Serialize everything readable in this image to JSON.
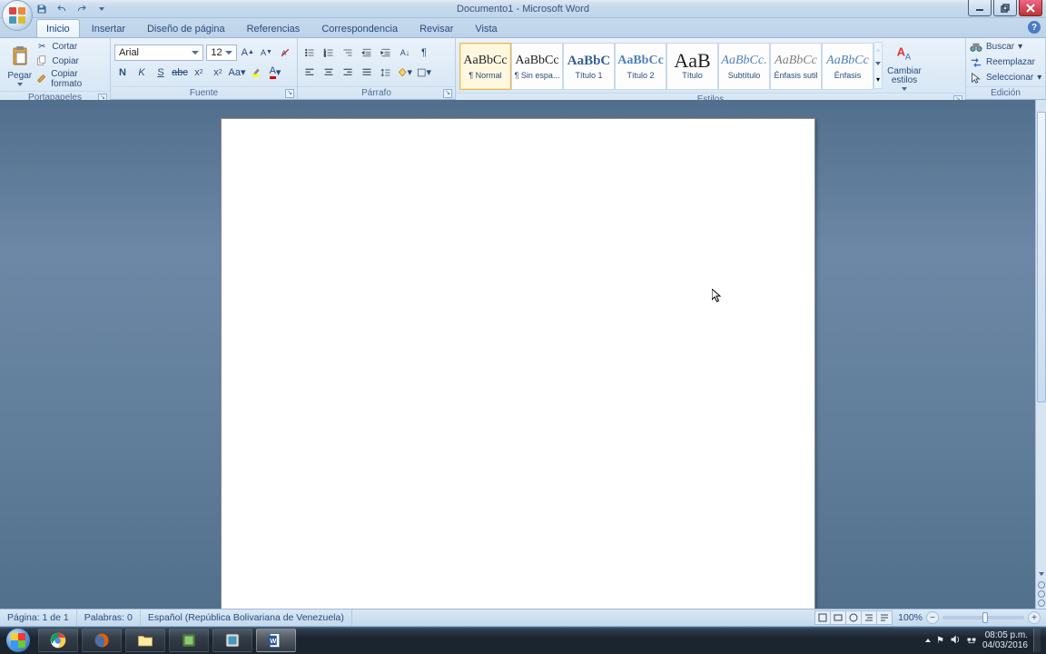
{
  "titlebar": {
    "doc_title": "Documento1 - Microsoft Word"
  },
  "tabs": {
    "inicio": "Inicio",
    "insertar": "Insertar",
    "diseno": "Diseño de página",
    "referencias": "Referencias",
    "correspondencia": "Correspondencia",
    "revisar": "Revisar",
    "vista": "Vista"
  },
  "ribbon": {
    "clipboard": {
      "paste": "Pegar",
      "cut": "Cortar",
      "copy": "Copiar",
      "format_painter": "Copiar formato",
      "label": "Portapapeles"
    },
    "font": {
      "name": "Arial",
      "size": "12",
      "label": "Fuente"
    },
    "paragraph": {
      "label": "Párrafo"
    },
    "styles": {
      "label": "Estilos",
      "change": "Cambiar estilos",
      "items": [
        {
          "preview": "AaBbCc",
          "name": "¶ Normal",
          "selected": true
        },
        {
          "preview": "AaBbCc",
          "name": "¶ Sin espa...",
          "selected": false
        },
        {
          "preview": "AaBbC",
          "name": "Título 1",
          "selected": false,
          "color": "#365f91",
          "size": "15px",
          "weight": "bold"
        },
        {
          "preview": "AaBbCc",
          "name": "Título 2",
          "selected": false,
          "color": "#4f81bd",
          "size": "14px",
          "weight": "bold"
        },
        {
          "preview": "AaB",
          "name": "Título",
          "selected": false,
          "size": "22px"
        },
        {
          "preview": "AaBbCc.",
          "name": "Subtítulo",
          "selected": false,
          "color": "#4f81bd",
          "style": "italic"
        },
        {
          "preview": "AaBbCc",
          "name": "Énfasis sutil",
          "selected": false,
          "color": "#808080",
          "style": "italic"
        },
        {
          "preview": "AaBbCc",
          "name": "Énfasis",
          "selected": false,
          "color": "#4f81bd",
          "style": "italic"
        }
      ]
    },
    "editing": {
      "find": "Buscar",
      "replace": "Reemplazar",
      "select": "Seleccionar",
      "label": "Edición"
    }
  },
  "statusbar": {
    "page": "Página: 1 de 1",
    "words": "Palabras: 0",
    "language": "Español (República Bolivariana de Venezuela)",
    "zoom": "100%"
  },
  "taskbar": {
    "time": "08:05 p.m.",
    "date": "04/03/2016"
  }
}
